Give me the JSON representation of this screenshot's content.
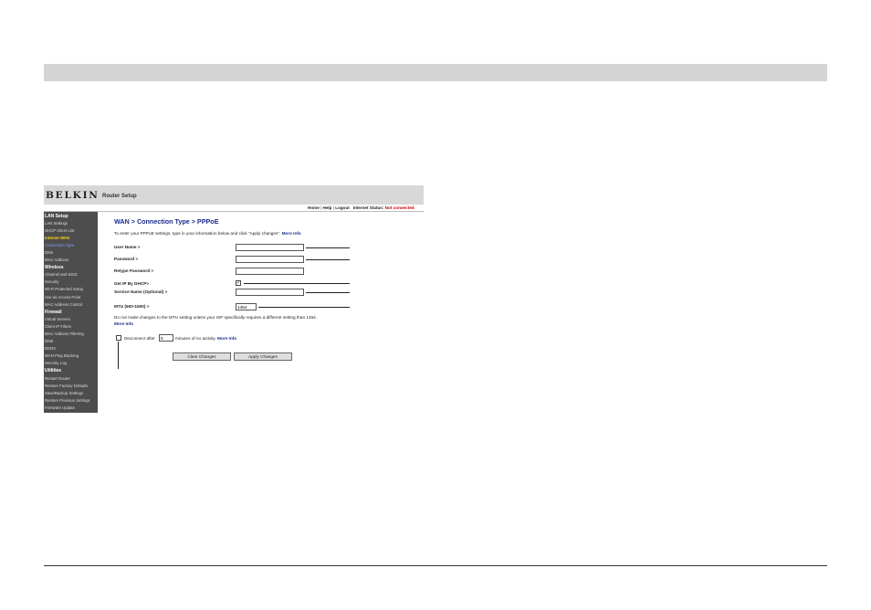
{
  "app": {
    "brand": "BELKIN",
    "title": "Router Setup"
  },
  "topnav": {
    "home": "Home",
    "help": "Help",
    "logout": "Logout",
    "separator": "|",
    "status_label": "Internet Status:",
    "status_value": "Not connected"
  },
  "sidebar": {
    "items": [
      {
        "label": "LAN Setup",
        "kind": "heading"
      },
      {
        "label": "LAN Settings",
        "kind": "item"
      },
      {
        "label": "DHCP Client List",
        "kind": "item"
      },
      {
        "label": "Internet WAN",
        "kind": "current"
      },
      {
        "label": "Connection Type",
        "kind": "sub-active"
      },
      {
        "label": "DNS",
        "kind": "item"
      },
      {
        "label": "MAC Address",
        "kind": "item"
      },
      {
        "label": "Wireless",
        "kind": "heading"
      },
      {
        "label": "Channel and SSID",
        "kind": "item"
      },
      {
        "label": "Security",
        "kind": "item"
      },
      {
        "label": "Wi-Fi Protected Setup",
        "kind": "item"
      },
      {
        "label": "Use as Access Point",
        "kind": "item"
      },
      {
        "label": "MAC Address Control",
        "kind": "item"
      },
      {
        "label": "Firewall",
        "kind": "heading"
      },
      {
        "label": "Virtual Servers",
        "kind": "item"
      },
      {
        "label": "Client IP Filters",
        "kind": "item"
      },
      {
        "label": "MAC Address Filtering",
        "kind": "item"
      },
      {
        "label": "DMZ",
        "kind": "item"
      },
      {
        "label": "DDNS",
        "kind": "item"
      },
      {
        "label": "WAN Ping Blocking",
        "kind": "item"
      },
      {
        "label": "Security Log",
        "kind": "item"
      },
      {
        "label": "Utilities",
        "kind": "heading"
      },
      {
        "label": "Restart Router",
        "kind": "item"
      },
      {
        "label": "Restore Factory Defaults",
        "kind": "item"
      },
      {
        "label": "Save/Backup Settings",
        "kind": "item"
      },
      {
        "label": "Restore Previous Settings",
        "kind": "item"
      },
      {
        "label": "Firmware Update",
        "kind": "item"
      }
    ]
  },
  "main": {
    "heading": "WAN > Connection Type > PPPoE",
    "intro": "To enter your PPPoE settings, type in your information below and click \"Apply changes\".",
    "more_info": "More Info",
    "fields": {
      "user_name": {
        "label": "User Name >",
        "value": ""
      },
      "password": {
        "label": "Password >",
        "value": ""
      },
      "retype_password": {
        "label": "Retype Password >",
        "value": ""
      },
      "get_ip_dhcp": {
        "label": "Get IP By DHCP>",
        "checked": true
      },
      "service_name": {
        "label": "Service Name (Optional) >",
        "value": ""
      },
      "mtu": {
        "label": "MTU (500-1500) >",
        "value": "1454"
      }
    },
    "mtu_note": "Do not make changes to the MTU setting unless your ISP specifically requires a different setting than 1454.",
    "mtu_more_info": "More Info",
    "disconnect": {
      "checked": false,
      "label_before": "Disconnect after",
      "minutes_value": "5",
      "label_after": "minutes of no activity.",
      "more_info": "More Info"
    },
    "buttons": {
      "clear": "Clear Changes",
      "apply": "Apply Changes"
    }
  },
  "colors": {
    "sidebar_bg": "#4d4d4d",
    "heading_blue": "#1c2c8c",
    "current_item": "#ffd21a",
    "status_red": "#cc0000"
  }
}
